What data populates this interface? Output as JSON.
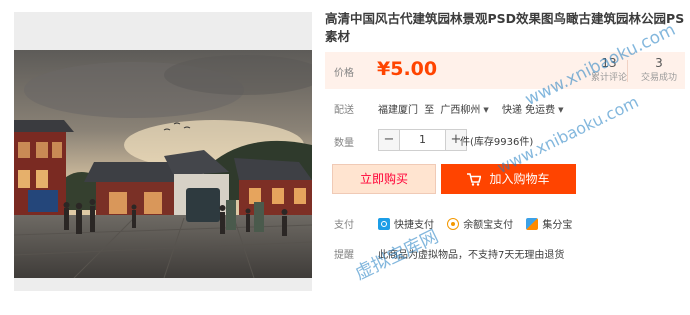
{
  "product": {
    "title": "高清中国风古代建筑园林景观PSD效果图鸟瞰古建筑园林公园PS素材"
  },
  "price": {
    "label": "价格",
    "value": "¥5.00"
  },
  "stats": {
    "reviews_count": "13",
    "reviews_label": "累计评论",
    "sales_count": "3",
    "sales_label": "交易成功"
  },
  "shipping": {
    "label": "配送",
    "from": "福建厦门",
    "to_word": "至",
    "destination": "广西柳州",
    "method": "快递 免运费"
  },
  "quantity": {
    "label": "数量",
    "minus": "−",
    "value": "1",
    "plus": "+",
    "stock_text": "件(库存9936件)"
  },
  "actions": {
    "buy_now": "立即购买",
    "add_to_cart": "加入购物车"
  },
  "payment": {
    "label": "支付",
    "methods": [
      "快捷支付",
      "余额宝支付",
      "集分宝"
    ],
    "icons": [
      "alipay-icon",
      "yuebao-icon",
      "jifenbao-icon"
    ]
  },
  "reminder": {
    "label": "提醒",
    "text": "此商品为虚拟物品，不支持7天无理由退货"
  },
  "watermarks": [
    "www.xnibaoku.com",
    "www.xnibaoku.com",
    "虚拟宝库网"
  ],
  "colors": {
    "accent": "#ff4400",
    "price_bg": "#fff1ea",
    "buy_bg": "#ffe4d0",
    "watermark": "#1f7ec2"
  }
}
